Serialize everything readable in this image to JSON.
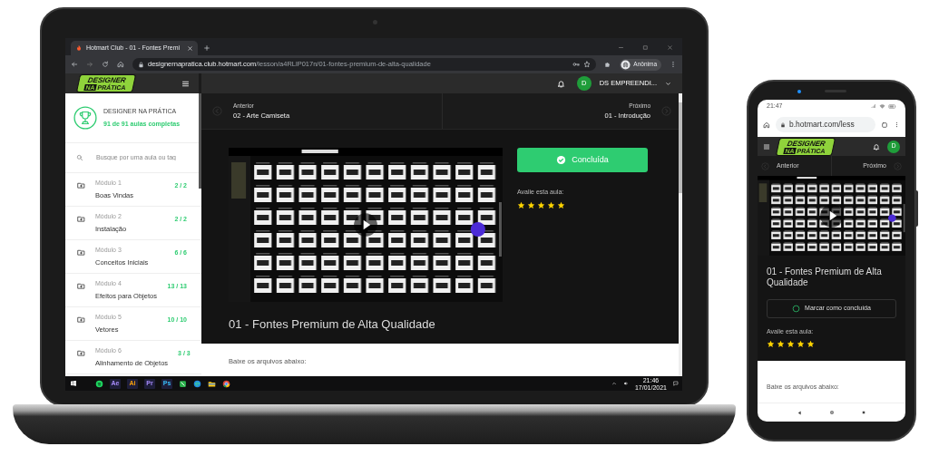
{
  "laptop": {
    "browser": {
      "tab_title": "Hotmart Club - 01 - Fontes Premi",
      "url_host": "designernapratica.club.hotmart.com",
      "url_path": "/lesson/a4RLlP017n/01-fontes-premium-de-alta-qualidade",
      "profile": "Anônima"
    },
    "app": {
      "logo": [
        "DESIGNER",
        "NA",
        "PRÁTICA"
      ],
      "user_avatar": "D",
      "user_name": "DS EMPREENDI...",
      "course": {
        "title": "DESIGNER NA PRÁTICA",
        "completed": "91 de 91 aulas completas"
      },
      "search": {
        "placeholder": "Busque por uma aula ou tag"
      },
      "modules": [
        {
          "label": "Módulo 1",
          "title": "Boas Vindas",
          "count": "2 / 2"
        },
        {
          "label": "Módulo 2",
          "title": "Instalação",
          "count": "2 / 2"
        },
        {
          "label": "Módulo 3",
          "title": "Conceitos Iniciais",
          "count": "6 / 6"
        },
        {
          "label": "Módulo 4",
          "title": "Efeitos para Objetos",
          "count": "13 / 13"
        },
        {
          "label": "Módulo 5",
          "title": "Vetores",
          "count": "10 / 10"
        },
        {
          "label": "Módulo 6",
          "title": "Alinhamento de Objetos",
          "count": "3 / 3"
        }
      ],
      "nav": {
        "previous": {
          "label": "Anterior",
          "title": "02 - Arte Camiseta"
        },
        "next": {
          "label": "Próximo",
          "title": "01 - Introdução"
        }
      },
      "complete_button": {
        "label": "Concluída",
        "done": true
      },
      "rating": {
        "label": "Avalie esta aula:",
        "stars": 5
      },
      "lesson_title": "01 - Fontes Premium de Alta Qualidade",
      "downloads_label": "Baixe os arquivos abaixo:"
    },
    "taskbar": {
      "app_badges": [
        "Ae",
        "Ai",
        "Pr",
        "Ps"
      ],
      "time": "21:46",
      "date": "17/01/2021"
    }
  },
  "phone": {
    "status_time": "21:47",
    "url": "b.hotmart.com/less",
    "logo": [
      "DESIGNER",
      "NA",
      "PRÁTICA"
    ],
    "user_avatar": "D",
    "nav": {
      "previous": "Anterior",
      "next": "Próximo"
    },
    "lesson_title": "01 - Fontes Premium de Alta Qualidade",
    "complete_button": {
      "label": "Marcar como concluída",
      "done": false
    },
    "rating": {
      "label": "Avalie esta aula:",
      "stars": 5
    },
    "downloads_label": "Baixe os arquivos abaixo:"
  }
}
